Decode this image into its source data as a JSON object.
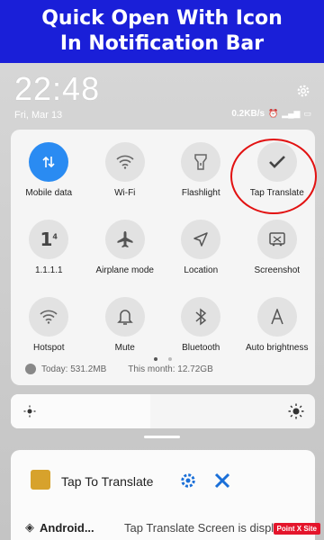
{
  "banner": {
    "line1": "Quick Open With Icon",
    "line2": "In Notification Bar",
    "color": "#1a1fd8"
  },
  "header": {
    "time": "22:48",
    "date": "Fri, Mar 13",
    "speed": "0.2KB/s",
    "icons": [
      "alarm-icon",
      "signal-icon",
      "battery-icon"
    ],
    "settings_icon": "gear-icon"
  },
  "quick_tiles": [
    {
      "label": "Mobile data",
      "icon": "mobile-data-icon",
      "active": true
    },
    {
      "label": "Wi-Fi",
      "icon": "wifi-icon",
      "active": false
    },
    {
      "label": "Flashlight",
      "icon": "flashlight-icon",
      "active": false
    },
    {
      "label": "Tap Translate",
      "icon": "check-icon",
      "active": false,
      "highlighted": true
    },
    {
      "label": "1.1.1.1",
      "icon": "one-icon",
      "active": false
    },
    {
      "label": "Airplane mode",
      "icon": "airplane-icon",
      "active": false
    },
    {
      "label": "Location",
      "icon": "location-icon",
      "active": false
    },
    {
      "label": "Screenshot",
      "icon": "screenshot-icon",
      "active": false
    },
    {
      "label": "Hotspot",
      "icon": "hotspot-icon",
      "active": false
    },
    {
      "label": "Mute",
      "icon": "bell-icon",
      "active": false
    },
    {
      "label": "Bluetooth",
      "icon": "bluetooth-icon",
      "active": false
    },
    {
      "label": "Auto brightness",
      "icon": "auto-brightness-icon",
      "active": false
    }
  ],
  "page_indicator": {
    "pages": 2,
    "current": 1
  },
  "data_usage": {
    "today": "Today: 531.2MB",
    "month": "This month: 12.72GB"
  },
  "brightness": {
    "level": 0.46
  },
  "notification": {
    "app_name": "Tap To Translate",
    "row2_app": "Android...",
    "row2_text": "Tap Translate Screen is display"
  },
  "watermark": "Point X Site",
  "colors": {
    "accent": "#2a8bf2",
    "highlight": "#e21212",
    "settings_blue": "#1a6fd8"
  }
}
